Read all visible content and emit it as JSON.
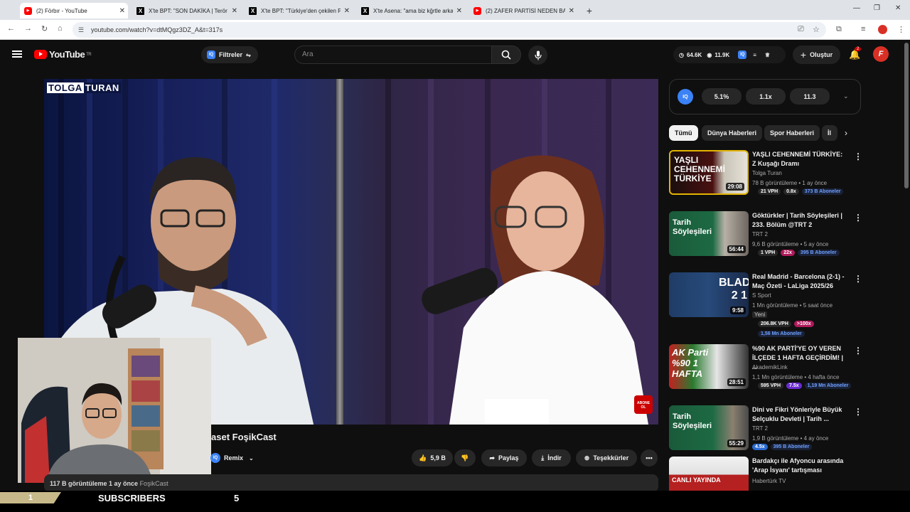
{
  "browser": {
    "tabs": [
      {
        "label": "(2) Förbır - YouTube",
        "icon": "youtube-icon"
      },
      {
        "label": "X'te BPT: \"SON DAKİKA | Terör ö",
        "icon": "x-icon"
      },
      {
        "label": "X'te BPT: \"Türkiye'den çekilen P",
        "icon": "x-icon"
      },
      {
        "label": "X'te Asena: \"ama biz kğrtle arka",
        "icon": "x-icon"
      },
      {
        "label": "(2) ZAFER PARTİSİ NEDEN BAŞA",
        "icon": "youtube-icon"
      }
    ],
    "url": "youtube.com/watch?v=dtMQgz3DZ_A&t=317s"
  },
  "header": {
    "logo": "YouTube",
    "region": "TR",
    "filter_label": "Filtreler",
    "search_placeholder": "Ara",
    "stats": {
      "views": "64.6K",
      "eye": "11.9K"
    },
    "create_label": "Oluştur",
    "notif_count": "2"
  },
  "video": {
    "overlay_logo_a": "TOLGA",
    "overlay_logo_b": "TURAN",
    "title": "aset FoşikCast",
    "remix_label": "Remix",
    "likes": "5,9 B",
    "share_label": "Paylaş",
    "download_label": "İndir",
    "thanks_label": "Teşekkürler",
    "views_meta": "117 B görüntüleme   1 ay önce",
    "channel_meta": "FoşikCast",
    "abone_badge": "ABONE OL"
  },
  "iq_panel": {
    "logo": "IQ",
    "values": [
      "5.1%",
      "1.1x",
      "11.3"
    ]
  },
  "chips": [
    "Tümü",
    "Dünya Haberleri",
    "Spor Haberleri",
    "İl"
  ],
  "recommendations": [
    {
      "title": "YAŞLI CEHENNEMİ TÜRKİYE: Z Kuşağı Dramı",
      "channel": "Tolga Turan",
      "meta": "78 B görüntüleme • 1 ay önce",
      "duration": "29:08",
      "thumb_text": "YAŞLI CEHENNEMİ TÜRKİYE",
      "tags": [
        {
          "t": "21 VPH",
          "bg": "#272727",
          "c": "#fff"
        },
        {
          "t": "0.8x",
          "bg": "#272727",
          "c": "#fff"
        },
        {
          "t": "373 B Aboneler",
          "bg": "#1a2238",
          "c": "#6ea0ff"
        }
      ]
    },
    {
      "title": "Göktürkler | Tarih Söyleşileri | 233. Bölüm @TRT 2",
      "channel": "TRT 2",
      "meta": "9,6 B görüntüleme • 5 ay önce",
      "duration": "56:44",
      "thumb_text": "Tarih Söyleşileri",
      "tags": [
        {
          "t": "1 VPH",
          "bg": "#272727",
          "c": "#fff"
        },
        {
          "t": "22x",
          "bg": "#b0195a",
          "c": "#fff"
        },
        {
          "t": "395 B Aboneler",
          "bg": "#1a2238",
          "c": "#6ea0ff"
        }
      ]
    },
    {
      "title": "Real Madrid - Barcelona (2-1) - Maç Özeti - LaLiga 2025/26",
      "channel": "S Sport",
      "meta": "1 Mn görüntüleme • 5 saat önce",
      "duration": "9:58",
      "thumb_text": "BLADE 2 1",
      "extra": "Yeni",
      "tags": [
        {
          "t": "206.8K VPH",
          "bg": "#272727",
          "c": "#fff"
        },
        {
          "t": ">100x",
          "bg": "#b0195a",
          "c": "#fff"
        }
      ],
      "subs": "1,56 Mn Aboneler"
    },
    {
      "title": "%90 AK PARTİ'YE OY VEREN İLÇEDE 1 HAFTA GEÇİRDİM! | ...",
      "channel": "AkademikLink",
      "meta": "1,1 Mn görüntüleme • 4 hafta önce",
      "duration": "28:51",
      "thumb_text": "AK Parti %90 1 HAFTA",
      "tags": [
        {
          "t": "595 VPH",
          "bg": "#272727",
          "c": "#fff"
        },
        {
          "t": "7.5x",
          "bg": "#6a2bd1",
          "c": "#fff"
        },
        {
          "t": "1,19 Mn Aboneler",
          "bg": "#1a2238",
          "c": "#6ea0ff"
        }
      ]
    },
    {
      "title": "Dini ve Fikri Yönleriyle Büyük Selçuklu Devleti | Tarih ...",
      "channel": "TRT 2",
      "meta": "1,9 B görüntüleme • 4 ay önce",
      "duration": "55:29",
      "thumb_text": "Tarih Söyleşileri",
      "tags": [
        {
          "t": "4.5x",
          "bg": "#2a6ad1",
          "c": "#fff"
        },
        {
          "t": "395 B Aboneler",
          "bg": "#1a2238",
          "c": "#6ea0ff"
        }
      ]
    },
    {
      "title": "Bardakçı ile Afyoncu arasında 'Arap İsyanı' tartışması",
      "channel": "Habertürk TV",
      "meta": "",
      "duration": "",
      "thumb_text": "CANLI YAYINDA",
      "tags": []
    }
  ],
  "subscriber_bar": {
    "rank": "1",
    "label": "SUBSCRIBERS",
    "count": "5"
  }
}
